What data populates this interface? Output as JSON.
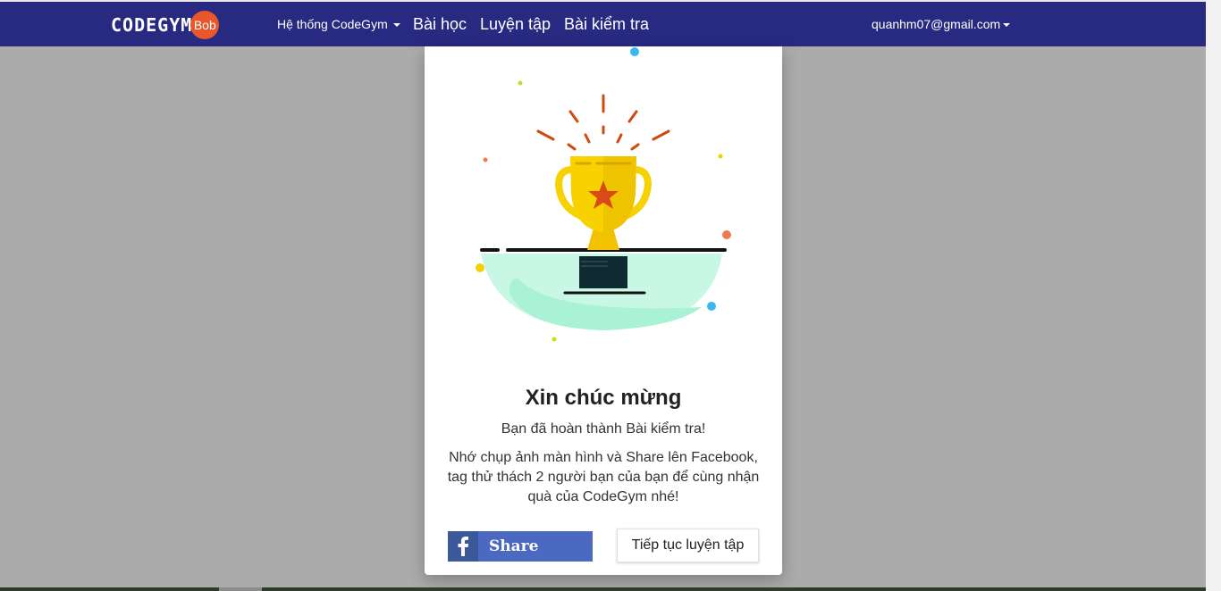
{
  "header": {
    "logo_text": "CODEGYM",
    "logo_badge": "Bob",
    "nav": {
      "system": "Hệ thống CodeGym",
      "lessons": "Bài học",
      "practice": "Luyện tập",
      "tests": "Bài kiểm tra"
    },
    "user_email": "quanhm07@gmail.com"
  },
  "modal": {
    "title": "Xin chúc mừng",
    "subtitle": "Bạn đã hoàn thành Bài kiểm tra!",
    "message": "Nhớ chụp ảnh màn hình và Share lên Facebook, tag thử thách 2 người bạn của bạn để cùng nhận quà của CodeGym nhé!",
    "share_label": "Share",
    "continue_label": "Tiếp tục luyện tập"
  },
  "colors": {
    "navbar": "#272a80",
    "facebook": "#4b69c0",
    "trophy": "#f7d200",
    "rays": "#d04a0f"
  }
}
